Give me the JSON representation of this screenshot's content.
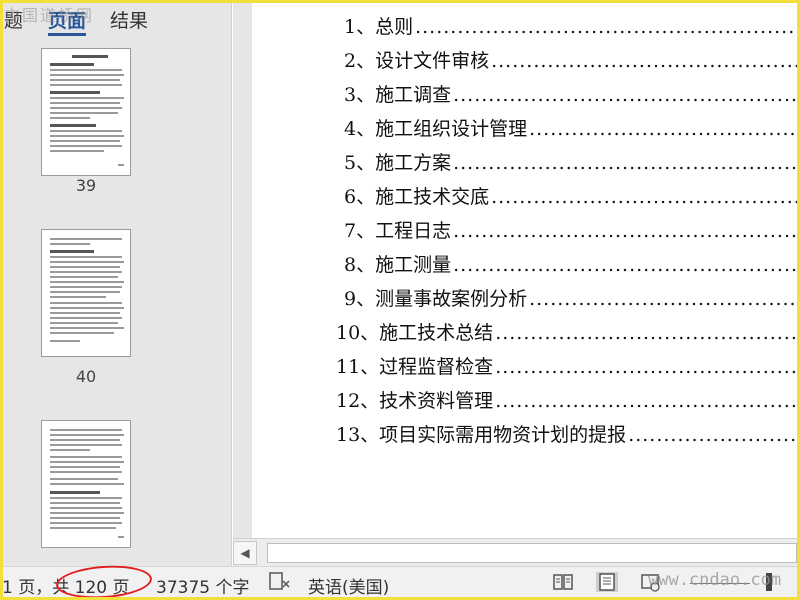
{
  "nav": {
    "watermark": "中国道桥网",
    "tabs": [
      "题",
      "页面",
      "结果"
    ],
    "active_tab": "页面",
    "thumbnails": [
      {
        "page": "39"
      },
      {
        "page": "40"
      },
      {
        "page": ""
      }
    ]
  },
  "document": {
    "toc": [
      {
        "label": "1、总则"
      },
      {
        "label": "2、设计文件审核"
      },
      {
        "label": "3、施工调查"
      },
      {
        "label": "4、施工组织设计管理"
      },
      {
        "label": "5、施工方案"
      },
      {
        "label": "6、施工技术交底"
      },
      {
        "label": "7、工程日志"
      },
      {
        "label": "8、施工测量"
      },
      {
        "label": "9、测量事故案例分析"
      },
      {
        "label": "10、施工技术总结"
      },
      {
        "label": "11、过程监督检查"
      },
      {
        "label": "12、技术资料管理"
      },
      {
        "label": "13、项目实际需用物资计划的提报"
      }
    ]
  },
  "status_bar": {
    "page_info": "1 页，共 120 页",
    "word_count": "37375 个字",
    "language": "英语(美国)",
    "site_watermark": "www.cndao.com"
  },
  "colors": {
    "frame": "#f2df3a",
    "accent": "#2b579a",
    "highlight_oval": "#e21e1e"
  }
}
